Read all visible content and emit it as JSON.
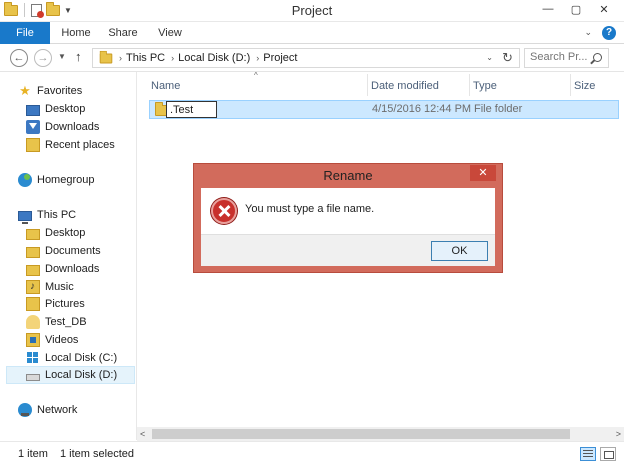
{
  "window": {
    "title": "Project",
    "minimize": "—",
    "maximize": "▢",
    "close": "✕"
  },
  "ribbon": {
    "tabs": [
      "File",
      "Home",
      "Share",
      "View"
    ],
    "expand_glyph": "⌄",
    "help_glyph": "?"
  },
  "address": {
    "back_glyph": "←",
    "forward_glyph": "→",
    "up_glyph": "↑",
    "crumbs": [
      "This PC",
      "Local Disk (D:)",
      "Project"
    ],
    "separator": "›",
    "dropdown_glyph": "⌄",
    "refresh_glyph": "↻"
  },
  "search": {
    "placeholder": "Search Pr..."
  },
  "nav_pane": {
    "favorites": {
      "label": "Favorites",
      "items": [
        "Desktop",
        "Downloads",
        "Recent places"
      ]
    },
    "homegroup": "Homegroup",
    "this_pc": {
      "label": "This PC",
      "items": [
        "Desktop",
        "Documents",
        "Downloads",
        "Music",
        "Pictures",
        "Test_DB",
        "Videos",
        "Local Disk (C:)",
        "Local Disk (D:)"
      ]
    },
    "network": "Network",
    "selected": "Local Disk (D:)"
  },
  "file_list": {
    "columns": [
      "Name",
      "Date modified",
      "Type",
      "Size"
    ],
    "sort_glyph": "^",
    "rows": [
      {
        "name": ".Test",
        "date_modified": "4/15/2016 12:44 PM",
        "type": "File folder",
        "size": ""
      }
    ]
  },
  "scrollbar": {
    "left_glyph": "<",
    "right_glyph": ">"
  },
  "status": {
    "item_count": "1 item",
    "selected": "1 item selected"
  },
  "dialog": {
    "title": "Rename",
    "message": "You must type a file name.",
    "ok_label": "OK",
    "close_glyph": "✕",
    "icon": "error-icon"
  },
  "colors": {
    "accent": "#1979ca",
    "dialog_frame": "#d26b5c",
    "selection": "#cce8ff",
    "error": "#c8302c"
  }
}
